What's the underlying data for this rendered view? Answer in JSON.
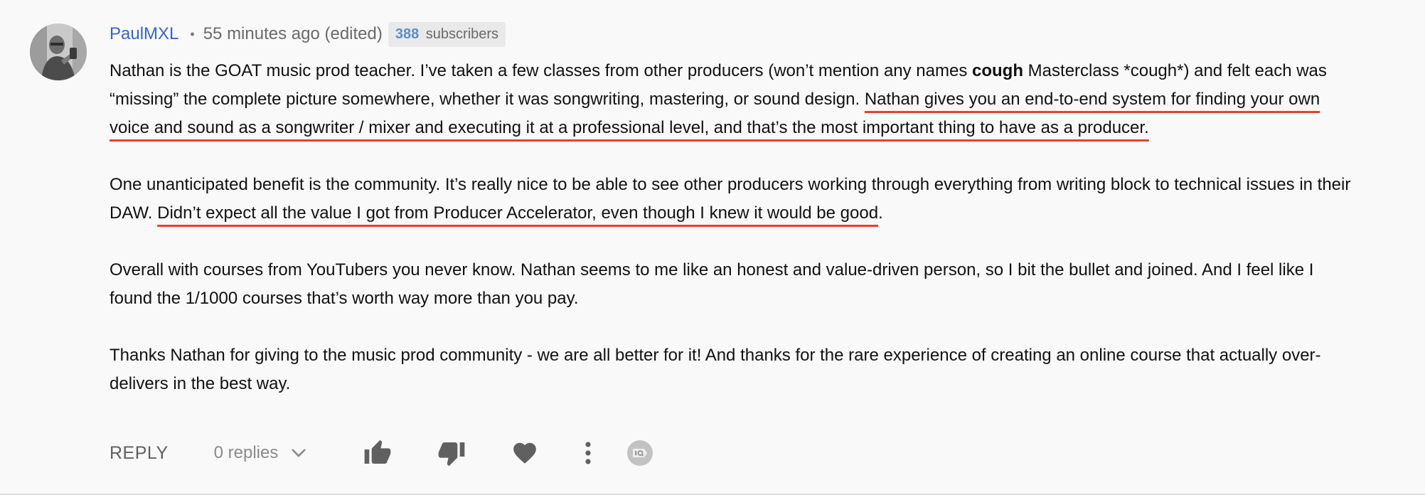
{
  "comment": {
    "author": "PaulMXL",
    "separator": "•",
    "time": "55 minutes ago (edited)",
    "subscriber_count": "388",
    "subscriber_label": "subscribers",
    "paragraphs": [
      {
        "segments": [
          {
            "text": "Nathan is the GOAT music prod teacher. I’ve taken a few classes from other producers (won’t mention any names ",
            "style": "normal"
          },
          {
            "text": "cough",
            "style": "bold"
          },
          {
            "text": " Masterclass *cough*) and felt each was “missing” the complete picture somewhere, whether it was songwriting, mastering, or sound design. ",
            "style": "normal"
          },
          {
            "text": "Nathan gives you an end-to-end system for finding your own voice and sound as a songwriter / mixer and executing it at a professional level, and that’s the most important thing to have as a producer.",
            "style": "underline"
          }
        ]
      },
      {
        "segments": [
          {
            "text": "One unanticipated benefit is the community. It’s really nice to be able to see other producers working through everything from writing block to technical issues in their DAW. ",
            "style": "normal"
          },
          {
            "text": "Didn’t expect all the value I got from Producer Accelerator, even though I knew it would be good",
            "style": "underline"
          },
          {
            "text": ".",
            "style": "normal"
          }
        ]
      },
      {
        "segments": [
          {
            "text": "Overall with courses from YouTubers you never know. Nathan seems to me like an honest and value-driven person, so I bit the bullet and joined. And I feel like I found the 1/1000 courses that’s worth way more than you pay.",
            "style": "normal"
          }
        ]
      },
      {
        "segments": [
          {
            "text": "Thanks Nathan for giving to the music prod community - we are all better for it! And thanks for the rare experience of creating an online course that actually over-delivers in the best way.",
            "style": "normal"
          }
        ]
      }
    ]
  },
  "actions": {
    "reply_label": "REPLY",
    "replies_label": "0 replies",
    "icons": [
      "thumbs-up-icon",
      "thumbs-down-icon",
      "heart-icon",
      "more-vert-icon",
      "iq-badge-icon"
    ]
  },
  "colors": {
    "author": "#3366cc",
    "underline": "#e8402f",
    "subscriber_count": "#5b8fc7",
    "icon": "#606060"
  }
}
